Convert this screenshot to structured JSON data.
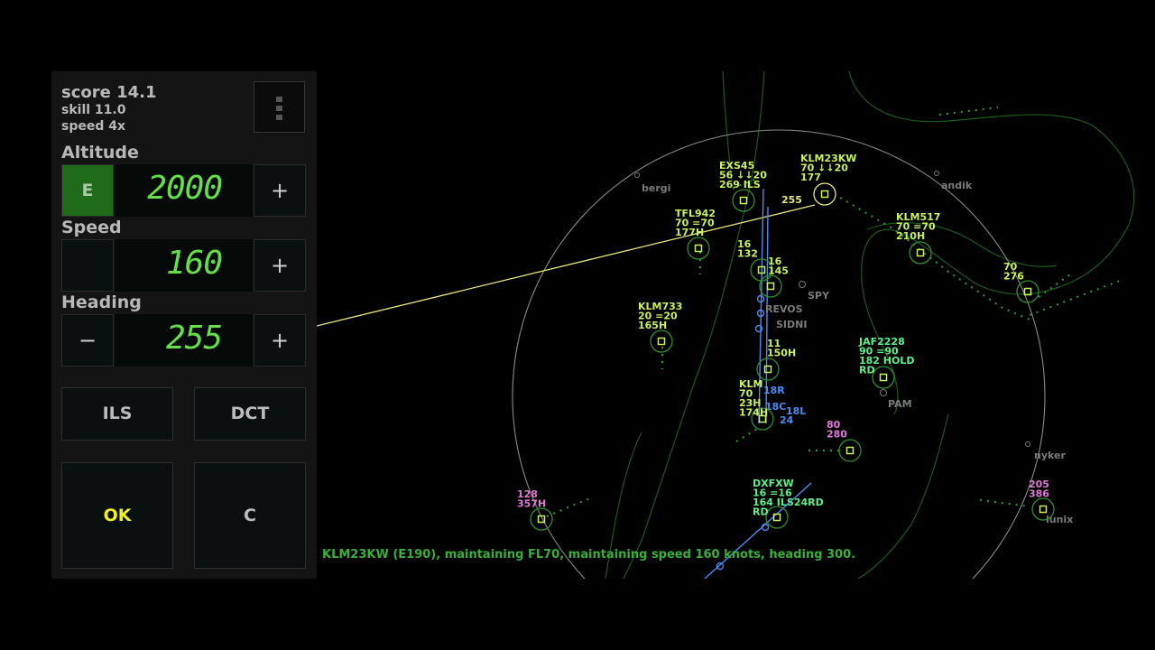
{
  "stats": {
    "score": "score 14.1",
    "skill": "skill 11.0",
    "speed": "speed 4x"
  },
  "altitude": {
    "label": "Altitude",
    "mode_btn": "E",
    "value": "2000",
    "plus": "+"
  },
  "speed": {
    "label": "Speed",
    "value": "160",
    "plus": "+"
  },
  "heading": {
    "label": "Heading",
    "minus": "−",
    "value": "255",
    "plus": "+"
  },
  "buttons": {
    "ils": "ILS",
    "dct": "DCT",
    "ok": "OK",
    "clear": "C"
  },
  "status_message": "KLM23KW (E190), maintaining FL70, maintaining speed 160 knots, heading 300.",
  "colors": {
    "label_green": "#c9f25a",
    "label_cyan": "#5cf08c",
    "label_pink": "#e07ad8",
    "runway_blue": "#4a8cf0",
    "ring_green": "#2f8f2f",
    "track_line": "#e6e680",
    "ok_yellow": "#f0f020"
  },
  "waypoints": [
    "bergi",
    "andik",
    "SPY",
    "REVOS",
    "SIDNI",
    "PAM",
    "nyker",
    "lunix"
  ],
  "runways": [
    "18R",
    "18C",
    "18L",
    "24"
  ],
  "selected_heading_label": "255",
  "aircraft": [
    {
      "lines": [
        "EXS45",
        "56 ↓↓20",
        "269  ILS"
      ],
      "color": "label_green"
    },
    {
      "lines": [
        "KLM23KW",
        "70 ↓↓20",
        "177"
      ],
      "color": "label_green"
    },
    {
      "lines": [
        "TFL942",
        "70 =70",
        "177H"
      ],
      "color": "label_green"
    },
    {
      "lines": [
        "16",
        "132"
      ],
      "color": "label_green"
    },
    {
      "lines": [
        "16",
        "145"
      ],
      "color": "label_green"
    },
    {
      "lines": [
        "KLM517",
        "70 =70",
        "210H"
      ],
      "color": "label_green"
    },
    {
      "lines": [
        "70",
        "276"
      ],
      "color": "label_green"
    },
    {
      "lines": [
        "KLM733",
        "20 =20",
        "165H"
      ],
      "color": "label_green"
    },
    {
      "lines": [
        "11",
        "150H"
      ],
      "color": "label_green"
    },
    {
      "lines": [
        "JAF2228",
        "90 =90",
        "182  HOLD",
        "RD"
      ],
      "color": "label_cyan"
    },
    {
      "lines": [
        "KLM",
        "70",
        "23H",
        "174H"
      ],
      "color": "label_green"
    },
    {
      "lines": [
        "80",
        "280"
      ],
      "color": "label_pink"
    },
    {
      "lines": [
        "128",
        "357H"
      ],
      "color": "label_pink"
    },
    {
      "lines": [
        "DXFXW",
        "16 =16",
        "164  ILS24RD",
        "RD"
      ],
      "color": "label_cyan"
    },
    {
      "lines": [
        "205",
        "386"
      ],
      "color": "label_pink"
    }
  ]
}
